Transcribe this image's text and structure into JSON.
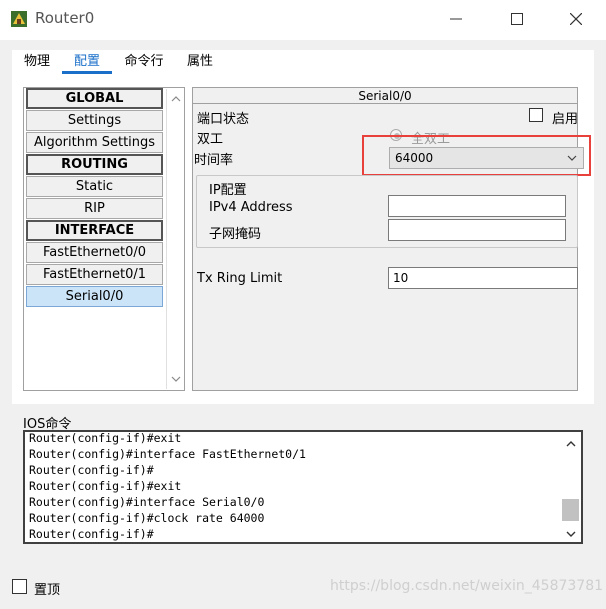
{
  "window": {
    "title": "Router0"
  },
  "tabs": [
    {
      "label": "物理"
    },
    {
      "label": "配置"
    },
    {
      "label": "命令行"
    },
    {
      "label": "属性"
    }
  ],
  "active_tab": "配置",
  "sidebar": {
    "items": [
      {
        "label": "GLOBAL",
        "kind": "header"
      },
      {
        "label": "Settings",
        "kind": "item"
      },
      {
        "label": "Algorithm Settings",
        "kind": "item"
      },
      {
        "label": "ROUTING",
        "kind": "header"
      },
      {
        "label": "Static",
        "kind": "item"
      },
      {
        "label": "RIP",
        "kind": "item"
      },
      {
        "label": "INTERFACE",
        "kind": "header"
      },
      {
        "label": "FastEthernet0/0",
        "kind": "item"
      },
      {
        "label": "FastEthernet0/1",
        "kind": "item"
      },
      {
        "label": "Serial0/0",
        "kind": "item",
        "selected": true
      }
    ]
  },
  "config": {
    "title": "Serial0/0",
    "port_status_label": "端口状态",
    "enable_label": "启用",
    "enabled": false,
    "duplex_label": "双工",
    "duplex_option": "全双工",
    "clock_rate_label": "时间率",
    "clock_rate_value": "64000",
    "ip_group_title": "IP配置",
    "ipv4_label": "IPv4 Address",
    "ipv4_value": "",
    "mask_label": "子网掩码",
    "mask_value": "",
    "tx_ring_label": "Tx Ring Limit",
    "tx_ring_value": "10"
  },
  "ios": {
    "label": "IOS命令",
    "lines": [
      "Router(config-if)#exit",
      "Router(config)#interface FastEthernet0/1",
      "Router(config-if)#",
      "Router(config-if)#exit",
      "Router(config)#interface Serial0/0",
      "Router(config-if)#clock rate 64000",
      "Router(config-if)#"
    ]
  },
  "bottom": {
    "top_label": "置顶"
  },
  "watermark": "https://blog.csdn.net/weixin_45873781",
  "colors": {
    "accent": "#1a6fc9",
    "highlight": "#e8403a",
    "selected": "#cce4f7"
  }
}
